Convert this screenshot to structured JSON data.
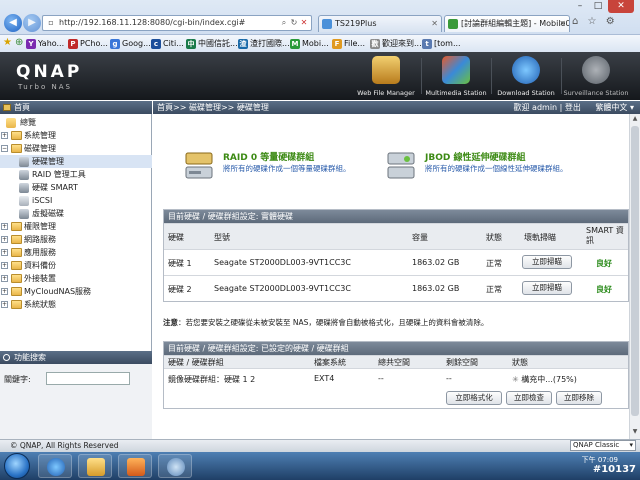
{
  "browser": {
    "url": "http://192.168.11.128:8080/cgi-bin/index.cgi#",
    "tabs": [
      {
        "label": "TS219Plus"
      },
      {
        "label": "[討論群組編輯主題] - Mobile01"
      }
    ],
    "favorites": [
      "Yaho...",
      "PCho...",
      "Goog...",
      "Citi...",
      "中國信託...",
      "渣打國際...",
      "Mobi...",
      "File...",
      "歡迎來到...",
      "[tom..."
    ]
  },
  "qnap": {
    "logo": "QNAP",
    "logo_sub": "Turbo NAS",
    "apps": [
      "Web File Manager",
      "Multimedia Station",
      "Download Station",
      "Surveillance Station"
    ]
  },
  "sidebar": {
    "title": "首頁",
    "items": [
      {
        "label": "總覽"
      },
      {
        "label": "系統管理"
      },
      {
        "label": "磁碟管理"
      },
      {
        "label": "硬碟管理"
      },
      {
        "label": "RAID 管理工具"
      },
      {
        "label": "硬碟 SMART"
      },
      {
        "label": "iSCSI"
      },
      {
        "label": "虛擬磁碟"
      },
      {
        "label": "權限管理"
      },
      {
        "label": "網路服務"
      },
      {
        "label": "應用服務"
      },
      {
        "label": "資料備份"
      },
      {
        "label": "外接裝置"
      },
      {
        "label": "MyCloudNAS服務"
      },
      {
        "label": "系統狀態"
      }
    ],
    "search_title": "功能搜索",
    "keyword_label": "關鍵字:"
  },
  "main": {
    "breadcrumb": "首頁>> 磁碟管理>> 硬碟管理",
    "welcome": "歡迎 admin | 登出",
    "language": "繁體中文",
    "options": [
      {
        "title": "RAID 0 等量硬碟群組",
        "desc": "將所有的硬碟作成一個等量硬碟群組。"
      },
      {
        "title": "JBOD 線性延伸硬碟群組",
        "desc": "將所有的硬碟作成一個線性延伸硬碟群組。"
      }
    ],
    "physical": {
      "title": "目前硬碟 / 硬碟群組設定: 實體硬碟",
      "headers": [
        "硬碟",
        "型號",
        "容量",
        "狀態",
        "壞軌掃瞄",
        "SMART 資訊"
      ],
      "rows": [
        {
          "disk": "硬碟 1",
          "model": "Seagate ST2000DL003-9VT1CC3C",
          "capacity": "1863.02 GB",
          "status": "正常",
          "scan": "立即掃瞄",
          "smart": "良好"
        },
        {
          "disk": "硬碟 2",
          "model": "Seagate ST2000DL003-9VT1CC3C",
          "capacity": "1863.02 GB",
          "status": "正常",
          "scan": "立即掃瞄",
          "smart": "良好"
        }
      ]
    },
    "note_label": "注意",
    "note_text": "：若您要安裝之硬碟從未被安裝至 NAS，硬碟將會自動被格式化，且硬碟上的資料會被清除。",
    "configured": {
      "title": "目前硬碟 / 硬碟群組設定: 已設定的硬碟 / 硬碟群組",
      "headers": [
        "硬碟 / 硬碟群組",
        "檔案系統",
        "總共空間",
        "剩餘空間",
        "狀態"
      ],
      "row": {
        "name": "鏡像硬碟群組：硬碟 1 2",
        "fs": "EXT4",
        "total": "--",
        "free": "--",
        "status": "構充中...(75%)"
      },
      "progress": 0.75,
      "buttons": [
        "立即格式化",
        "立即檢查",
        "立即移除"
      ]
    }
  },
  "footer": {
    "copyright": "© QNAP, All Rights Reserved",
    "theme": "QNAP Classic"
  },
  "taskbar": {
    "time": "下午 07:09",
    "watermark": "#10137"
  }
}
